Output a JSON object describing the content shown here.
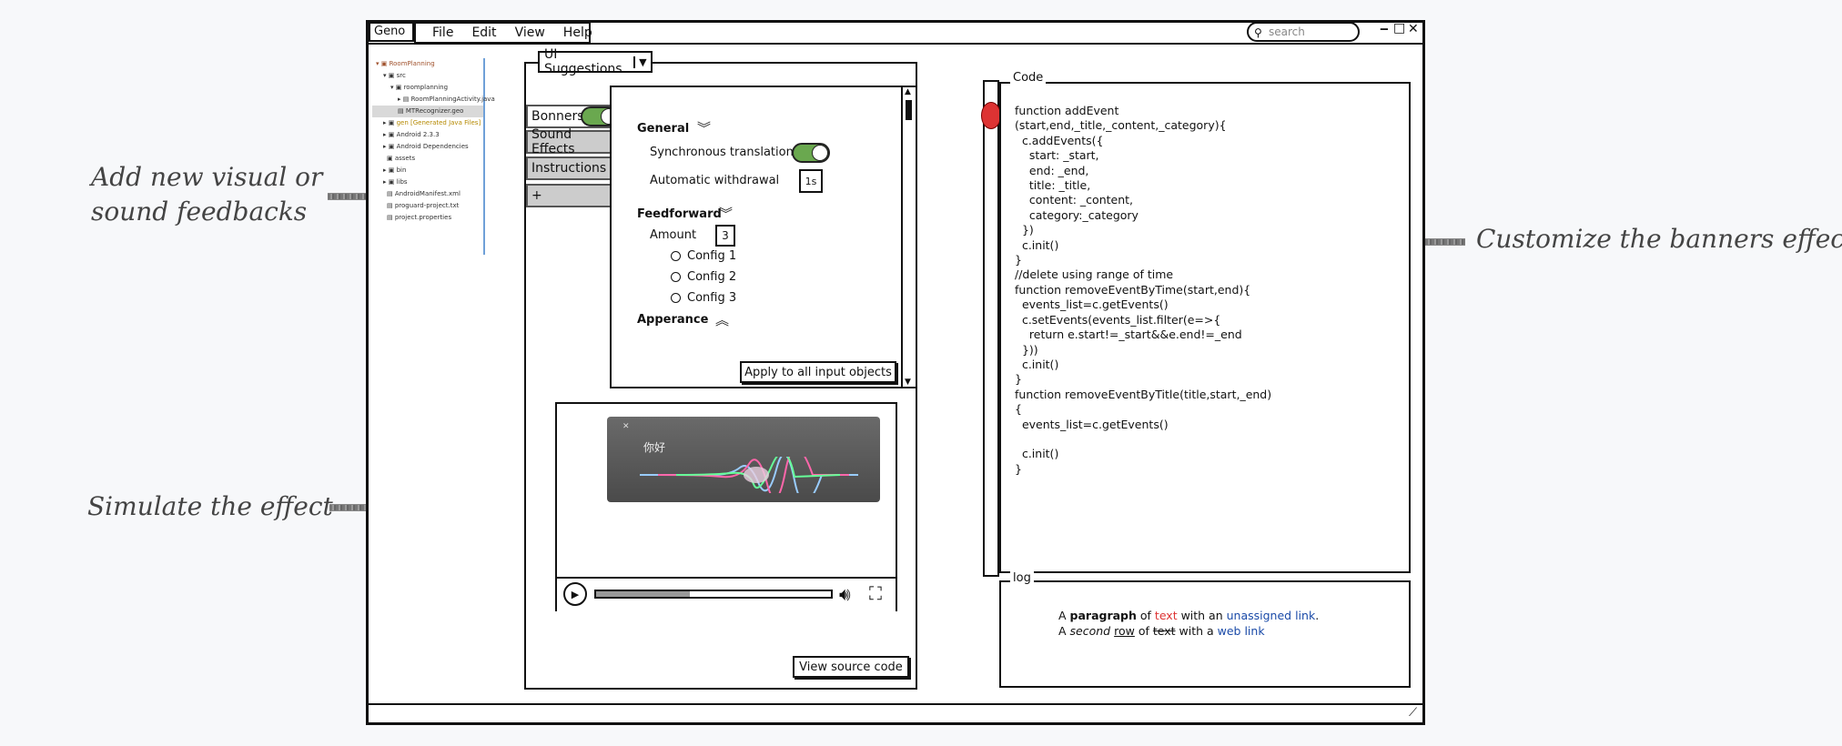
{
  "annotations": {
    "add_feedback": "Add new visual or\nsound feedbacks",
    "simulate": "Simulate the effect",
    "customize": "Customize the banners effect"
  },
  "window": {
    "app_name": "Geno",
    "menu": [
      "File",
      "Edit",
      "View",
      "Help"
    ],
    "search_placeholder": "search",
    "controls": {
      "minimize": "‒",
      "maximize": "□",
      "close": "✕"
    }
  },
  "explorer": {
    "items": [
      "RoomPlanning",
      "src",
      "roomplanning",
      "RoomPlanningActivity.java",
      "MTRecognizer.geo",
      "gen [Generated Java Files]",
      "Android 2.3.3",
      "Android Dependencies",
      "assets",
      "bin",
      "libs",
      "AndroidManifest.xml",
      "proguard-project.txt",
      "project.properties"
    ]
  },
  "suggestions": {
    "dropdown_label": "UI Suggestions",
    "tabs": [
      "Bonners",
      "Sound Effects",
      "Instructions",
      "+"
    ],
    "general_heading": "General",
    "sync_label": "Synchronous translation",
    "auto_label": "Automatic withdrawal",
    "auto_value": "1s",
    "feedforward_heading": "Feedforward",
    "amount_label": "Amount",
    "amount_value": "3",
    "configs": [
      "Config 1",
      "Config 2",
      "Config 3"
    ],
    "appearance_heading": "Apperance",
    "apply_button": "Apply to all input objects",
    "view_source_button": "View source code"
  },
  "preview": {
    "banner_text": "你好",
    "progress": 0.4
  },
  "code_panel": {
    "title": "Code",
    "code": "function addEvent\n(start,end,_title,_content,_category){\n  c.addEvents({\n    start: _start,\n    end: _end,\n    title: _title,\n    content: _content,\n    category:_category\n  })\n  c.init()\n}\n//delete using range of time\nfunction removeEventByTime(start,end){\n  events_list=c.getEvents()\n  c.setEvents(events_list.filter(e=>{\n    return e.start!=_start&&e.end!=_end\n  }))\n  c.init()\n}\nfunction removeEventByTitle(title,start,_end)\n{\n  events_list=c.getEvents()\n\n  c.init()\n}"
  },
  "log_panel": {
    "title": "log",
    "line1": [
      "A ",
      "paragraph",
      " of ",
      "text",
      " with an ",
      "unassigned link",
      "."
    ],
    "line2": [
      "A ",
      "second",
      " ",
      "row",
      " of ",
      "text",
      " with a ",
      "web link"
    ]
  },
  "colors": {
    "toggle_on": "#6aa84f",
    "breakpoint": "#d33",
    "link": "#1a4aa8",
    "red_text": "#d33"
  }
}
